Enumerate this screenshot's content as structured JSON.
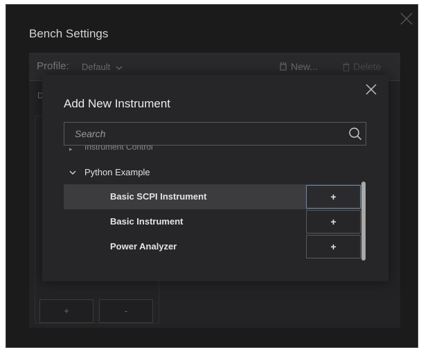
{
  "bench": {
    "title": "Bench Settings",
    "profile_label": "Profile:",
    "profile_value": "Default",
    "new_label": "New...",
    "delete_label": "Delete",
    "panel_letter": "D",
    "add_label": "+",
    "remove_label": "-"
  },
  "modal": {
    "title": "Add New Instrument",
    "search_placeholder": "Search",
    "search_value": "",
    "cut_off_label": "Instrument Control",
    "group_label": "Python Example",
    "items": [
      {
        "label": "Basic SCPI Instrument",
        "button": "+",
        "selected": true
      },
      {
        "label": "Basic Instrument",
        "button": "+",
        "selected": false
      },
      {
        "label": "Power Analyzer",
        "button": "+",
        "selected": false
      }
    ]
  },
  "icons": {
    "close": "close-icon",
    "search": "search-icon",
    "chevron": "chevron-down-icon",
    "new": "new-icon",
    "delete": "trash-icon"
  },
  "colors": {
    "background": "#1b1b1c",
    "modal": "#262628",
    "selected_row": "#3c3c3f",
    "focus_border": "#6a8ab0"
  }
}
